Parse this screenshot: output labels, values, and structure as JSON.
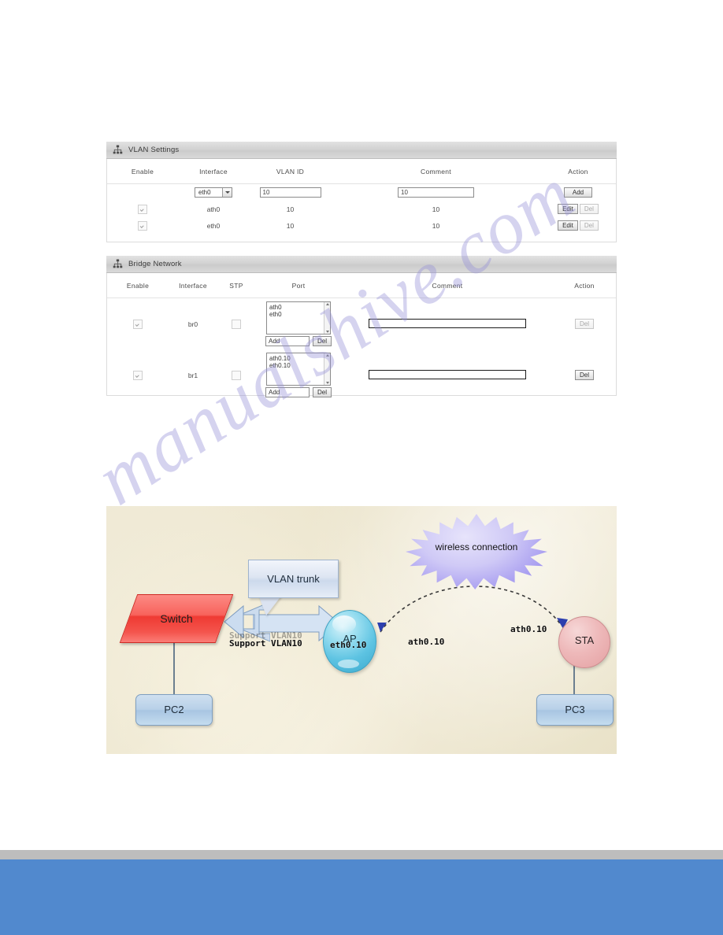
{
  "vlan_panel": {
    "title": "VLAN Settings",
    "icon": "sitemap-icon",
    "columns": [
      "Enable",
      "Interface",
      "VLAN ID",
      "Comment",
      "Action"
    ],
    "new_row": {
      "interface_value": "eth0",
      "vlan_id_value": "10",
      "comment_value": "10",
      "add_label": "Add"
    },
    "rows": [
      {
        "enabled": true,
        "interface": "ath0",
        "vlan_id": "10",
        "comment": "10",
        "edit_label": "Edit",
        "del_label": "Del"
      },
      {
        "enabled": true,
        "interface": "eth0",
        "vlan_id": "10",
        "comment": "10",
        "edit_label": "Edit",
        "del_label": "Del"
      }
    ]
  },
  "bridge_panel": {
    "title": "Bridge Network",
    "icon": "sitemap-icon",
    "columns": [
      "Enable",
      "Interface",
      "STP",
      "Port",
      "Comment",
      "Action"
    ],
    "rows": [
      {
        "enabled": true,
        "interface": "br0",
        "stp": false,
        "ports": [
          "ath0",
          "eth0"
        ],
        "port_add_label": "Add",
        "port_del_label": "Del",
        "comment": "",
        "action_del_label": "Del"
      },
      {
        "enabled": true,
        "interface": "br1",
        "stp": false,
        "ports": [
          "ath0.10",
          "eth0.10"
        ],
        "port_add_label": "Add",
        "port_del_label": "Del",
        "comment": "",
        "action_del_label": "Del"
      }
    ]
  },
  "diagram": {
    "nodes": {
      "switch": "Switch",
      "ap": "AP",
      "sta": "STA",
      "pc2": "PC2",
      "pc3": "PC3"
    },
    "callout": "VLAN trunk",
    "starburst": "wireless connection",
    "labels": {
      "support_vlan": "Support VLAN10",
      "eth_vlan": "eth0.10",
      "ap_ath_vlan": "ath0.10",
      "sta_ath_vlan": "ath0.10"
    },
    "colors": {
      "switch": "#ef3a33",
      "ap": "#5dc3e2",
      "sta": "#e4a0a2",
      "pc": "#b8d0e8",
      "starburst": "#a79cf0",
      "background": "#ece5cd"
    }
  },
  "watermark": {
    "text": "manualshive.com"
  },
  "footer": {
    "gray_color": "#bdbdbd",
    "blue_color": "#5189ce"
  }
}
